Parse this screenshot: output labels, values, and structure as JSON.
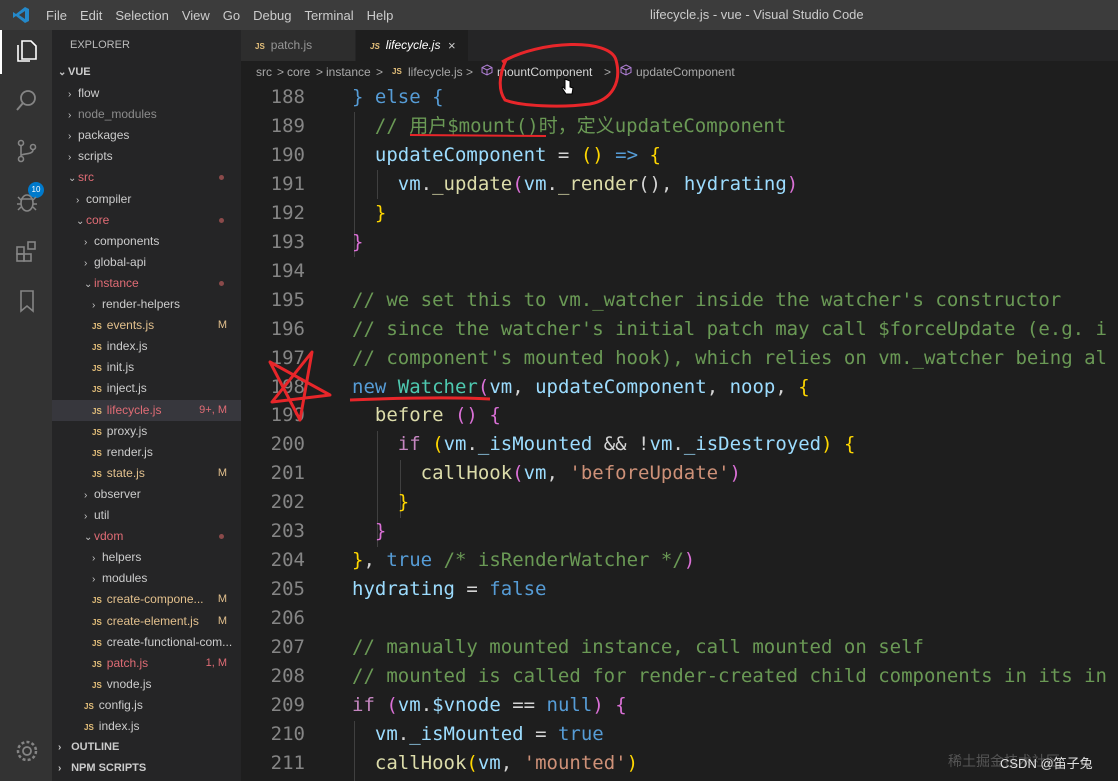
{
  "window": {
    "title": "lifecycle.js - vue - Visual Studio Code"
  },
  "menu": [
    "File",
    "Edit",
    "Selection",
    "View",
    "Go",
    "Debug",
    "Terminal",
    "Help"
  ],
  "activity": {
    "scm_badge": "10"
  },
  "explorer": {
    "header": "EXPLORER",
    "root": "VUE",
    "items": [
      {
        "label": "flow",
        "depth": 0,
        "type": "folder",
        "state": "collapsed"
      },
      {
        "label": "node_modules",
        "depth": 0,
        "type": "folder",
        "state": "collapsed",
        "dim": true
      },
      {
        "label": "packages",
        "depth": 0,
        "type": "folder",
        "state": "collapsed"
      },
      {
        "label": "scripts",
        "depth": 0,
        "type": "folder",
        "state": "collapsed"
      },
      {
        "label": "src",
        "depth": 0,
        "type": "folder",
        "state": "expanded",
        "color": "#e06c75",
        "dot": true
      },
      {
        "label": "compiler",
        "depth": 1,
        "type": "folder",
        "state": "collapsed"
      },
      {
        "label": "core",
        "depth": 1,
        "type": "folder",
        "state": "expanded",
        "color": "#e06c75",
        "dot": true
      },
      {
        "label": "components",
        "depth": 2,
        "type": "folder",
        "state": "collapsed"
      },
      {
        "label": "global-api",
        "depth": 2,
        "type": "folder",
        "state": "collapsed"
      },
      {
        "label": "instance",
        "depth": 2,
        "type": "folder",
        "state": "expanded",
        "color": "#e06c75",
        "dot": true
      },
      {
        "label": "render-helpers",
        "depth": 3,
        "type": "folder",
        "state": "collapsed"
      },
      {
        "label": "events.js",
        "depth": 3,
        "type": "file",
        "color": "#e2c08d",
        "badge": "M"
      },
      {
        "label": "index.js",
        "depth": 3,
        "type": "file"
      },
      {
        "label": "init.js",
        "depth": 3,
        "type": "file"
      },
      {
        "label": "inject.js",
        "depth": 3,
        "type": "file"
      },
      {
        "label": "lifecycle.js",
        "depth": 3,
        "type": "file",
        "color": "#e06c75",
        "badge": "9+, M",
        "selected": true
      },
      {
        "label": "proxy.js",
        "depth": 3,
        "type": "file"
      },
      {
        "label": "render.js",
        "depth": 3,
        "type": "file"
      },
      {
        "label": "state.js",
        "depth": 3,
        "type": "file",
        "color": "#e2c08d",
        "badge": "M"
      },
      {
        "label": "observer",
        "depth": 2,
        "type": "folder",
        "state": "collapsed"
      },
      {
        "label": "util",
        "depth": 2,
        "type": "folder",
        "state": "collapsed"
      },
      {
        "label": "vdom",
        "depth": 2,
        "type": "folder",
        "state": "expanded",
        "color": "#e06c75",
        "dot": true
      },
      {
        "label": "helpers",
        "depth": 3,
        "type": "folder",
        "state": "collapsed"
      },
      {
        "label": "modules",
        "depth": 3,
        "type": "folder",
        "state": "collapsed"
      },
      {
        "label": "create-compone...",
        "depth": 3,
        "type": "file",
        "color": "#e2c08d",
        "badge": "M"
      },
      {
        "label": "create-element.js",
        "depth": 3,
        "type": "file",
        "color": "#e2c08d",
        "badge": "M"
      },
      {
        "label": "create-functional-com...",
        "depth": 3,
        "type": "file"
      },
      {
        "label": "patch.js",
        "depth": 3,
        "type": "file",
        "color": "#e06c75",
        "badge": "1, M"
      },
      {
        "label": "vnode.js",
        "depth": 3,
        "type": "file"
      },
      {
        "label": "config.js",
        "depth": 2,
        "type": "file"
      },
      {
        "label": "index.js",
        "depth": 2,
        "type": "file"
      }
    ],
    "sections": [
      "OUTLINE",
      "NPM SCRIPTS"
    ]
  },
  "tabs": [
    {
      "label": "patch.js",
      "icon": "JS"
    },
    {
      "label": "lifecycle.js",
      "icon": "JS",
      "active": true,
      "close": "×"
    }
  ],
  "breadcrumb": {
    "parts": [
      "src",
      ">",
      "core",
      ">",
      "instance",
      ">",
      "JS",
      "lifecycle.js",
      ">",
      "mountComponent",
      ">",
      "updateComponent"
    ]
  },
  "code": {
    "lines": [
      {
        "n": "188",
        "html": "<span class=\"kw\">} else {</span>"
      },
      {
        "n": "189",
        "html": "  <span class=\"cm\">// 用户$mount()时，定义updateComponent</span>"
      },
      {
        "n": "190",
        "html": "  <span class=\"vr\">updateComponent</span> = <span class=\"pb\">()</span> <span class=\"kw\">=></span> <span class=\"pb\">{</span>"
      },
      {
        "n": "191",
        "html": "    <span class=\"vr\">vm</span>.<span class=\"fn\">_update</span><span class=\"pa\">(</span><span class=\"vr\">vm</span>.<span class=\"fn\">_render</span>(), <span class=\"vr\">hydrating</span><span class=\"pa\">)</span>"
      },
      {
        "n": "192",
        "html": "  <span class=\"pb\">}</span>"
      },
      {
        "n": "193",
        "html": "<span class=\"pa\">}</span>"
      },
      {
        "n": "194",
        "html": ""
      },
      {
        "n": "195",
        "html": "<span class=\"cm\">// we set this to vm._watcher inside the watcher's constructor</span>"
      },
      {
        "n": "196",
        "html": "<span class=\"cm\">// since the watcher's initial patch may call $forceUpdate (e.g. i</span>"
      },
      {
        "n": "197",
        "html": "<span class=\"cm\">// component's mounted hook), which relies on vm._watcher being al</span>"
      },
      {
        "n": "198",
        "html": "<span class=\"kw\">new</span> <span class=\"cls\">Watcher</span><span class=\"pa\">(</span><span class=\"vr\">vm</span>, <span class=\"vr\">updateComponent</span>, <span class=\"vr\">noop</span>, <span class=\"pb\">{</span>"
      },
      {
        "n": "199",
        "html": "  <span class=\"fn\">before</span> <span class=\"pa\">()</span> <span class=\"pa\">{</span>"
      },
      {
        "n": "200",
        "html": "    <span class=\"kw\" style=\"color:#c586c0\">if</span> <span class=\"pb\">(</span><span class=\"vr\">vm</span>.<span class=\"vr\">_isMounted</span> &amp;&amp; !<span class=\"vr\">vm</span>.<span class=\"vr\">_isDestroyed</span><span class=\"pb\">)</span> <span class=\"pb\">{</span>"
      },
      {
        "n": "201",
        "html": "      <span class=\"fn\">callHook</span><span class=\"pa\">(</span><span class=\"vr\">vm</span>, <span class=\"str\">'beforeUpdate'</span><span class=\"pa\">)</span>"
      },
      {
        "n": "202",
        "html": "    <span class=\"pb\">}</span>"
      },
      {
        "n": "203",
        "html": "  <span class=\"pa\">}</span>"
      },
      {
        "n": "204",
        "html": "<span class=\"pb\">}</span>, <span class=\"kw\">true</span> <span class=\"cm\">/* isRenderWatcher */</span><span class=\"pa\">)</span>"
      },
      {
        "n": "205",
        "html": "<span class=\"vr\">hydrating</span> = <span class=\"kw\">false</span>"
      },
      {
        "n": "206",
        "html": ""
      },
      {
        "n": "207",
        "html": "<span class=\"cm\">// manually mounted instance, call mounted on self</span>"
      },
      {
        "n": "208",
        "html": "<span class=\"cm\">// mounted is called for render-created child components in its in</span>"
      },
      {
        "n": "209",
        "html": "<span class=\"kw\" style=\"color:#c586c0\">if</span> <span class=\"pa\">(</span><span class=\"vr\">vm</span>.<span class=\"vr\">$vnode</span> == <span class=\"kw\">null</span><span class=\"pa\">)</span> <span class=\"pa\">{</span>"
      },
      {
        "n": "210",
        "html": "  <span class=\"vr\">vm</span>.<span class=\"vr\">_isMounted</span> = <span class=\"kw\">true</span>"
      },
      {
        "n": "211",
        "html": "  <span class=\"fn\">callHook</span><span class=\"pb\">(</span><span class=\"vr\">vm</span>, <span class=\"str\">'mounted'</span><span class=\"pb\">)</span>"
      }
    ]
  },
  "watermark": {
    "text": "稀土掘金技术社区",
    "credit": "CSDN @笛子兔"
  }
}
